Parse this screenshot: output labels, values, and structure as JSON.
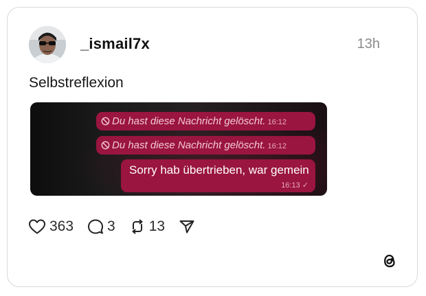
{
  "post": {
    "username": "_ismail7x",
    "timestamp": "13h",
    "text": "Selbstreflexion"
  },
  "screenshot_chat": {
    "messages": [
      {
        "text": "Du hast diese Nachricht gelöscht.",
        "time": "16:12",
        "deleted": true
      },
      {
        "text": "Du hast diese Nachricht gelöscht.",
        "time": "16:12",
        "deleted": true
      },
      {
        "text": "Sorry hab übertrieben, war gemein",
        "time": "16:13 ✓",
        "deleted": false
      }
    ],
    "bubble_color": "#9a1540"
  },
  "actions": {
    "likes": "363",
    "replies": "3",
    "reposts": "13"
  },
  "icons": [
    "heart-icon",
    "comment-icon",
    "repost-icon",
    "share-icon",
    "threads-logo-icon",
    "ban-icon"
  ],
  "colors": {
    "card_border": "#d9d9d9",
    "timestamp": "#8a8a8a",
    "text": "#111111"
  }
}
